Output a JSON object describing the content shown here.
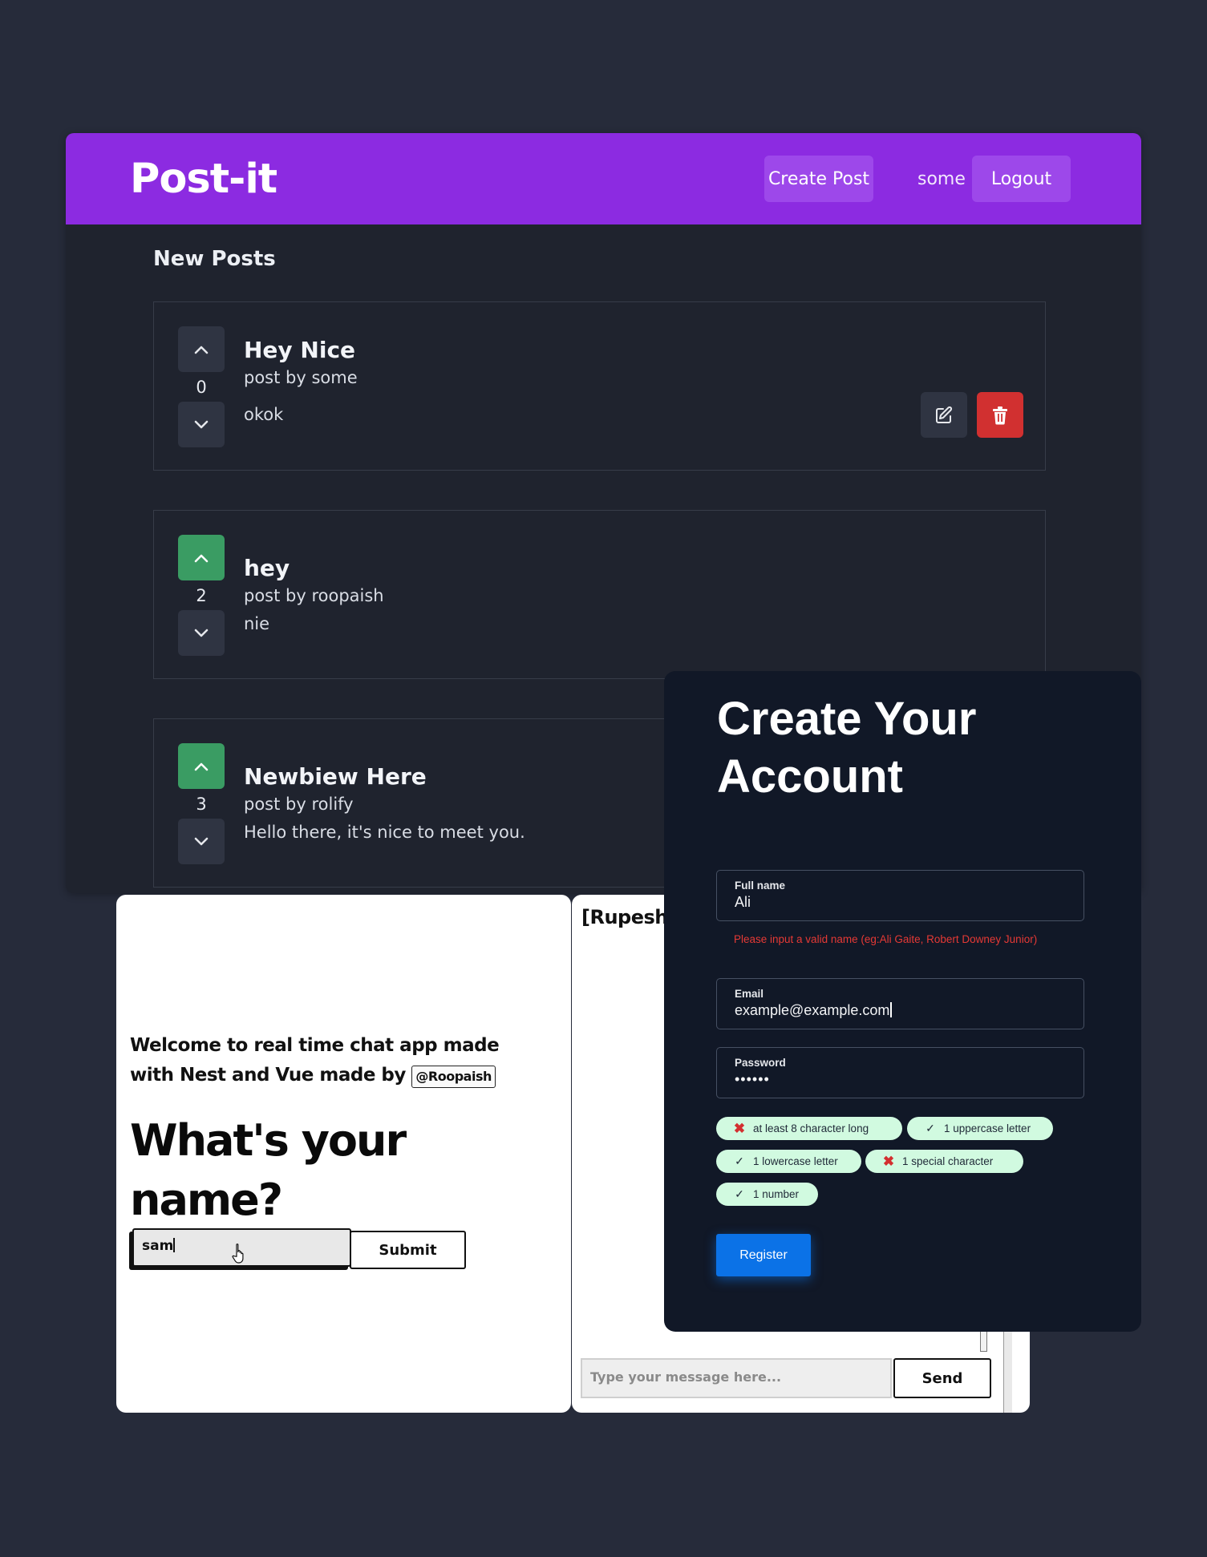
{
  "postit": {
    "brand": "Post-it",
    "nav": {
      "create_post": "Create Post",
      "username": "some",
      "logout": "Logout"
    },
    "section_title": "New Posts",
    "posts": [
      {
        "title": "Hey Nice",
        "byline": "post by some",
        "body": "okok",
        "votes": "0",
        "upvoted": false,
        "owner_actions": true
      },
      {
        "title": "hey",
        "byline": "post by roopaish",
        "body": "nie",
        "votes": "2",
        "upvoted": true,
        "owner_actions": false
      },
      {
        "title": "Newbiew Here",
        "byline": "post by rolify",
        "body": "Hello there, it's nice to meet you.",
        "votes": "3",
        "upvoted": true,
        "owner_actions": false
      }
    ],
    "colors": {
      "header": "#8c2be1",
      "upvote_active": "#3a9c63",
      "delete": "#d13030",
      "background": "#1f232e"
    }
  },
  "chat_welcome": {
    "welcome_text": "Welcome to real time chat app made with Nest and Vue made by",
    "author_tag": "@Roopaish",
    "question": "What's your name?",
    "name_value": "sam",
    "submit_label": "Submit"
  },
  "chat_room": {
    "room_title": "[Rupesh",
    "message_placeholder": "Type your message here...",
    "send_label": "Send"
  },
  "register": {
    "title": "Create Your Account",
    "full_name": {
      "label": "Full name",
      "value": "Ali",
      "error": "Please input a valid name (eg:Ali Gaite, Robert Downey Junior)"
    },
    "email": {
      "label": "Email",
      "value": "example@example.com"
    },
    "password": {
      "label": "Password",
      "value": "••••••"
    },
    "requirements": [
      {
        "label": "at least 8 character long",
        "met": false
      },
      {
        "label": "1 uppercase letter",
        "met": true
      },
      {
        "label": "1 lowercase letter",
        "met": true
      },
      {
        "label": "1 special character",
        "met": false
      },
      {
        "label": "1 number",
        "met": true
      }
    ],
    "register_label": "Register",
    "colors": {
      "card": "#111827",
      "primary": "#0b72e7",
      "error": "#e53935",
      "chip": "#d1fae0"
    }
  }
}
